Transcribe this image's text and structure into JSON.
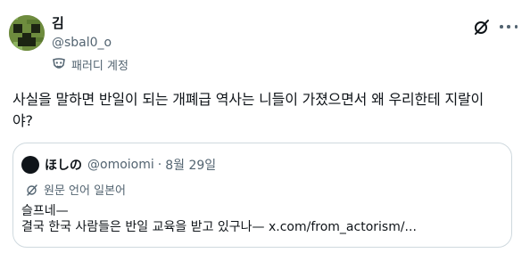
{
  "author": {
    "display_name": "김",
    "handle": "@sbal0_o",
    "parody_label": "패러디 계정",
    "avatar_icon": "creeper-avatar"
  },
  "actions": {
    "grok_icon": "grok-icon",
    "more_icon": "more-icon"
  },
  "tweet": {
    "text": "사실을 말하면 반일이 되는 개폐급 역사는 니들이 가졌으면서 왜 우리한테 지랄이\n야?"
  },
  "quote": {
    "display_name": "ほしの",
    "handle": "@omoiomi",
    "separator": "·",
    "date": "8월 29일",
    "translate_label": "원문 언어 일본어",
    "line1": "슬프네—",
    "line2": "결국 한국 사람들은 반일 교육을 받고 있구나— x.com/from_actorism/..."
  },
  "colors": {
    "text": "#0f1419",
    "secondary": "#536471",
    "border": "#cfd9de"
  }
}
